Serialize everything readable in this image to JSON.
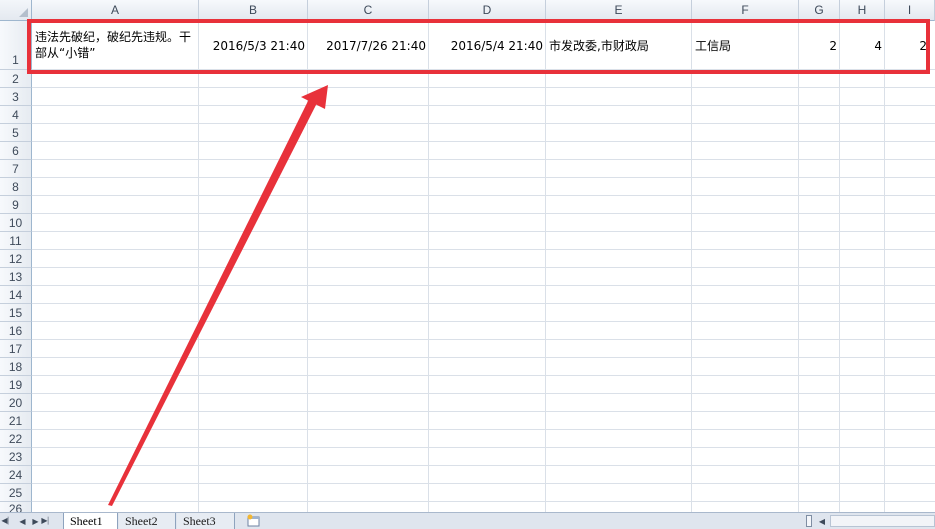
{
  "columns": [
    "A",
    "B",
    "C",
    "D",
    "E",
    "F",
    "G",
    "H",
    "I"
  ],
  "rows": [
    "1",
    "2",
    "3",
    "4",
    "5",
    "6",
    "7",
    "8",
    "9",
    "10",
    "11",
    "12",
    "13",
    "14",
    "15",
    "16",
    "17",
    "18",
    "19",
    "20",
    "21",
    "22",
    "23",
    "24",
    "25",
    "26"
  ],
  "row1": {
    "a": "违法先破纪，破纪先违规。干部从“小错”",
    "b": "2016/5/3 21:40",
    "c": "2017/7/26 21:40",
    "d": "2016/5/4 21:40",
    "e": "市发改委,市财政局",
    "f": "工信局",
    "g": "2",
    "h": "4",
    "i": "2"
  },
  "sheets": [
    "Sheet1",
    "Sheet2",
    "Sheet3"
  ],
  "active_sheet": "Sheet1",
  "icons": {
    "nav_first": "first-sheet-icon",
    "nav_prev": "prev-sheet-icon",
    "nav_next": "next-sheet-icon",
    "nav_last": "last-sheet-icon",
    "new_sheet": "insert-sheet-icon"
  },
  "colors": {
    "annotation": "#e8313a",
    "header_bg": "#e3e8ef",
    "grid": "#dae0e8"
  }
}
